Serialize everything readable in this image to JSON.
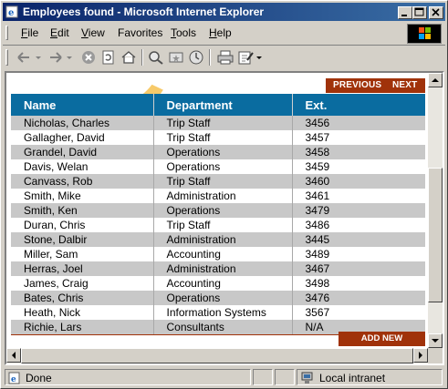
{
  "window": {
    "title": "Employees found - Microsoft Internet Explorer",
    "controls": {
      "minimize": "_",
      "maximize": "□",
      "close": "×"
    }
  },
  "menu": {
    "items": [
      {
        "label": "File",
        "accel": "F",
        "rest": "ile"
      },
      {
        "label": "Edit",
        "accel": "E",
        "rest": "dit"
      },
      {
        "label": "View",
        "accel": "V",
        "rest": "iew"
      },
      {
        "label": "Favorites",
        "accel": "",
        "rest": "Favorites"
      },
      {
        "label": "Tools",
        "accel": "T",
        "rest": "ools"
      },
      {
        "label": "Help",
        "accel": "H",
        "rest": "elp"
      }
    ]
  },
  "toolbar": {
    "icons": [
      "back-arrow-icon",
      "back-dropdown-icon",
      "forward-arrow-icon",
      "forward-dropdown-icon",
      "stop-icon",
      "refresh-icon",
      "home-icon",
      "search-icon",
      "favorites-icon",
      "history-icon",
      "print-icon",
      "edit-icon",
      "edit-dropdown-icon"
    ]
  },
  "page": {
    "nav": {
      "previous": "PREVIOUS",
      "next": "NEXT"
    },
    "columns": [
      "Name",
      "Department",
      "Ext."
    ],
    "rows": [
      {
        "name": "Nicholas, Charles",
        "department": "Trip Staff",
        "ext": "3456"
      },
      {
        "name": "Gallagher, David",
        "department": "Trip Staff",
        "ext": "3457"
      },
      {
        "name": "Grandel, David",
        "department": "Operations",
        "ext": "3458"
      },
      {
        "name": "Davis, Welan",
        "department": "Operations",
        "ext": "3459"
      },
      {
        "name": "Canvass, Rob",
        "department": "Trip Staff",
        "ext": "3460"
      },
      {
        "name": "Smith, Mike",
        "department": "Administration",
        "ext": "3461"
      },
      {
        "name": "Smith, Ken",
        "department": "Operations",
        "ext": "3479"
      },
      {
        "name": "Duran, Chris",
        "department": "Trip Staff",
        "ext": "3486"
      },
      {
        "name": "Stone, Dalbir",
        "department": "Administration",
        "ext": "3445"
      },
      {
        "name": "Miller, Sam",
        "department": "Accounting",
        "ext": "3489"
      },
      {
        "name": "Herras, Joel",
        "department": "Administration",
        "ext": "3467"
      },
      {
        "name": "James, Craig",
        "department": "Accounting",
        "ext": "3498"
      },
      {
        "name": "Bates, Chris",
        "department": "Operations",
        "ext": "3476"
      },
      {
        "name": "Heath, Nick",
        "department": "Information Systems",
        "ext": "3567"
      },
      {
        "name": "Richie, Lars",
        "department": "Consultants",
        "ext": "N/A"
      }
    ],
    "add_button": "ADD NEW EMPLOYEE"
  },
  "status": {
    "text": "Done",
    "zone": "Local intranet"
  },
  "colors": {
    "title_bar": "#0a246a",
    "header_bg": "#0a6ca0",
    "accent_brown": "#a0320a",
    "row_alt": "#c8c8c8",
    "chrome": "#d4d0c8"
  }
}
